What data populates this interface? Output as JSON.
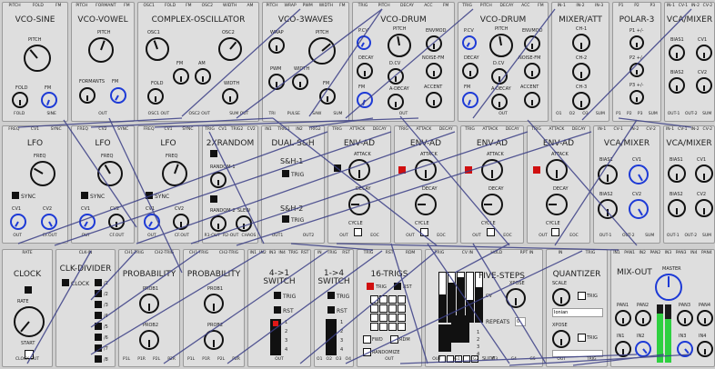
{
  "modules": {
    "vco_sine": {
      "title": "VCO-SINE",
      "top": [
        "PITCH",
        "FOLD",
        "FM"
      ],
      "bottom": [
        "FOLD",
        "SINE"
      ],
      "labels": [
        "PITCH",
        "FOLD",
        "FM"
      ]
    },
    "vco_vowel": {
      "title": "VCO-VOWEL",
      "top": [
        "PITCH",
        "FORMANT",
        "FM"
      ],
      "bottom": [
        "OUT"
      ],
      "labels": [
        "PITCH",
        "FORMANTS",
        "FM"
      ]
    },
    "complex_osc": {
      "title": "COMPLEX-OSCILLATOR",
      "top": [
        "OSC1",
        "FOLD",
        "FM",
        "OSC2",
        "WIDTH",
        "AM"
      ],
      "bottom": [
        "OSC1 OUT",
        "OSC2 OUT",
        "SUM OUT"
      ],
      "labels": [
        "OSC1",
        "OSC2",
        "FM",
        "AM",
        "FOLD",
        "WIDTH"
      ]
    },
    "vco_3waves": {
      "title": "VCO-3WAVES",
      "top": [
        "PITCH",
        "WRAP",
        "PWM",
        "WIDTH",
        "FM"
      ],
      "bottom": [
        "TRI",
        "PULSE",
        "SAW",
        "SUM"
      ],
      "labels": [
        "WRAP",
        "PITCH",
        "PWM",
        "WIDTH",
        "FM"
      ]
    },
    "vco_drum_1": {
      "title": "VCO-DRUM",
      "top": [
        "TRIG",
        "PITCH",
        "DECAY",
        "ACC",
        "FM"
      ],
      "bottom": [
        "OUT"
      ],
      "labels": [
        "P.CV",
        "PITCH",
        "ENVMOD",
        "DECAY",
        "D.CV",
        "NOISE-FM",
        "FM",
        "A-DECAY",
        "ACCENT"
      ]
    },
    "vco_drum_2": {
      "title": "VCO-DRUM",
      "top": [
        "TRIG",
        "PITCH",
        "DECAY",
        "ACC",
        "FM"
      ],
      "bottom": [
        "OUT"
      ],
      "labels": [
        "P.CV",
        "PITCH",
        "ENVMOD",
        "DECAY",
        "D.CV",
        "NOISE-FM",
        "FM",
        "A-DECAY",
        "ACCENT"
      ]
    },
    "mixer_att": {
      "title": "MIXER/ATT",
      "top": [
        "IN-1",
        "IN-2",
        "IN-3"
      ],
      "bottom": [
        "O1",
        "O2",
        "O3",
        "SUM"
      ],
      "labels": [
        "CH-1",
        "CH-2",
        "CH-3"
      ]
    },
    "polar_3": {
      "title": "POLAR-3",
      "top": [
        "P1",
        "P2",
        "P3"
      ],
      "bottom": [
        "P1",
        "P2",
        "P3",
        "SUM"
      ],
      "labels": [
        "P1 +/-",
        "P2 +/-",
        "P3 +/-"
      ]
    },
    "vca_mixer_1": {
      "title": "VCA/MIXER",
      "top": [
        "IN-1",
        "CV-1",
        "IN-2",
        "CV-2"
      ],
      "bottom": [
        "OUT-1",
        "OUT-2",
        "SUM"
      ],
      "labels": [
        "BIAS1",
        "CV1",
        "BIAS2",
        "CV2"
      ]
    },
    "lfo_1": {
      "title": "LFO",
      "top": [
        "FREQ",
        "CV1",
        "SYNC"
      ],
      "bottom": [
        "OUT",
        "CF.OUT"
      ],
      "labels": [
        "FREQ",
        "SYNC",
        "CV1",
        "CV2"
      ]
    },
    "lfo_2": {
      "title": "LFO",
      "top": [
        "FREQ",
        "CV2",
        "SYNC"
      ],
      "bottom": [
        "OUT",
        "CF.OUT"
      ],
      "labels": [
        "FREQ",
        "SYNC",
        "CV1",
        "CV2"
      ]
    },
    "lfo_3": {
      "title": "LFO",
      "top": [
        "FREQ",
        "CV1",
        "SYNC"
      ],
      "bottom": [
        "OUT",
        "CF.OUT"
      ],
      "labels": [
        "FREQ",
        "SYNC",
        "CV1",
        "CV2"
      ]
    },
    "random_2x": {
      "title": "2XRANDOM",
      "top": [
        "TRIG",
        "CV1",
        "TRIG2",
        "CV2"
      ],
      "bottom": [
        "R1-OUT",
        "R2-OUT",
        "CHAOS"
      ],
      "labels": [
        "RANDOM-1",
        "RANDOM-2",
        "SLEW"
      ]
    },
    "dual_sh": {
      "title": "DUAL-S&H",
      "top": [
        "IN1",
        "TRIG1",
        "IN2",
        "TRIG2"
      ],
      "bottom": [
        "OUT1",
        "OUT2"
      ],
      "labels": [
        "S&H-1",
        "TRIG",
        "S&H-2",
        "TRIG"
      ]
    },
    "env_ad_1": {
      "title": "ENV-AD",
      "top": [
        "TRIG",
        "ATTACK",
        "DECAY"
      ],
      "bottom": [
        "OUT",
        "EOC"
      ],
      "labels": [
        "ATTACK",
        "DECAY",
        "CYCLE"
      ]
    },
    "env_ad_2": {
      "title": "ENV-AD",
      "top": [
        "TRIG",
        "ATTACK",
        "DECAY"
      ],
      "bottom": [
        "OUT",
        "EOC"
      ],
      "labels": [
        "ATTACK",
        "DECAY",
        "CYCLE"
      ]
    },
    "env_ad_3": {
      "title": "ENV-AD",
      "top": [
        "TRIG",
        "ATTACK",
        "DECAY"
      ],
      "bottom": [
        "OUT",
        "EOC"
      ],
      "labels": [
        "ATTACK",
        "DECAY",
        "CYCLE"
      ]
    },
    "env_ad_4": {
      "title": "ENV-AD",
      "top": [
        "TRIG",
        "ATTACK",
        "DECAY"
      ],
      "bottom": [
        "OUT",
        "EOC"
      ],
      "labels": [
        "ATTACK",
        "DECAY",
        "CYCLE"
      ]
    },
    "vca_mixer_2": {
      "title": "VCA/MIXER",
      "top": [
        "IN-1",
        "CV-1",
        "IN-2",
        "CV-2"
      ],
      "bottom": [
        "OUT-1",
        "OUT-2",
        "SUM"
      ],
      "labels": [
        "BIAS1",
        "CV1",
        "BIAS2",
        "CV2"
      ]
    },
    "vca_mixer_3": {
      "title": "VCA/MIXER",
      "top": [
        "IN-1",
        "CV-1",
        "IN-2",
        "CV-2"
      ],
      "bottom": [
        "OUT-1",
        "OUT-2",
        "SUM"
      ],
      "labels": [
        "BIAS1",
        "CV1",
        "BIAS2",
        "CV2"
      ]
    },
    "clock": {
      "title": "CLOCK",
      "top": [
        "RATE"
      ],
      "bottom": [
        "CLOCK-OUT"
      ],
      "labels": [
        "RATE",
        "START"
      ]
    },
    "clk_divider": {
      "title": "CLK-DIVIDER",
      "top": [
        "CLK-IN"
      ],
      "bottom": [],
      "labels": [
        "CLOCK",
        "/1",
        "/2",
        "/3",
        "/4",
        "/5",
        "/6",
        "/7",
        "/8"
      ]
    },
    "probability_1": {
      "title": "PROBABILITY",
      "top": [
        "CH1-TRIG",
        "CH2-TRIG"
      ],
      "bottom": [
        "P1L",
        "P1R",
        "P2L",
        "P2R"
      ],
      "labels": [
        "PROB1",
        "PROB2"
      ]
    },
    "probability_2": {
      "title": "PROBABILITY",
      "top": [
        "CH1-TRIG",
        "CH2-TRIG"
      ],
      "bottom": [
        "P1L",
        "P1R",
        "P2L",
        "P2R"
      ],
      "labels": [
        "PROB1",
        "PROB2"
      ]
    },
    "switch_4to1": {
      "title": "4->1\nSWITCH",
      "top": [
        "IN1",
        "IN2",
        "IN3",
        "IN4",
        "TRIG",
        "RST"
      ],
      "bottom": [
        "OUT"
      ],
      "labels": [
        "TRIG",
        "RST",
        "1",
        "2",
        "3",
        "4"
      ]
    },
    "switch_1to4": {
      "title": "1->4\nSWITCH",
      "top": [
        "IN",
        "TRIG",
        "RST"
      ],
      "bottom": [
        "O1",
        "O2",
        "O3",
        "O4"
      ],
      "labels": [
        "TRIG",
        "RST",
        "1",
        "2",
        "3",
        "4"
      ]
    },
    "trigs_16": {
      "title": "16-TRIGS",
      "top": [
        "TRIG",
        "RST",
        "RDM"
      ],
      "bottom": [
        "OUT"
      ],
      "labels": [
        "TRIG",
        "RST",
        "FWD",
        "RDM",
        "RANDOMIZE"
      ]
    },
    "five_steps": {
      "title": "FIVE-STEPS",
      "top": [
        "TRIG",
        "CV IN",
        "HOLD",
        "RPT IN"
      ],
      "bottom": [
        "OUT",
        "G1",
        "G2",
        "G3",
        "G4",
        "G5"
      ],
      "labels": [
        "CV",
        "XPOSE",
        "REPEATS",
        "0",
        "1",
        "2",
        "3",
        "4",
        "SLIDE"
      ]
    },
    "quantizer": {
      "title": "QUANTIZER",
      "top": [
        "IN",
        "TRIG"
      ],
      "bottom": [
        "OUT",
        "TRIG"
      ],
      "labels": [
        "SCALE",
        "TRIG",
        "Ionian",
        "XPOSE",
        "TRIG"
      ]
    },
    "mix_out": {
      "title": "MIX-OUT",
      "top": [
        "IN1",
        "PAN1",
        "IN2",
        "PAN2",
        "IN3",
        "PAN3",
        "IN4",
        "PAN4"
      ],
      "bottom": [],
      "labels": [
        "MASTER",
        "PAN1",
        "PAN2",
        "PAN3",
        "PAN4",
        "IN1",
        "IN2",
        "IN3",
        "IN4"
      ]
    }
  },
  "five_steps_values": [
    0.55,
    0.8,
    0.9,
    0.45,
    0.7
  ],
  "mix_out_levels": [
    0.85,
    0.75
  ],
  "colors": {
    "panel": "#dedede",
    "background": "#cfcfcf",
    "knob_blue": "#1d3ad6",
    "led_red": "#e01818",
    "cable": "#3b3f86",
    "meter_green": "#2ed040"
  }
}
